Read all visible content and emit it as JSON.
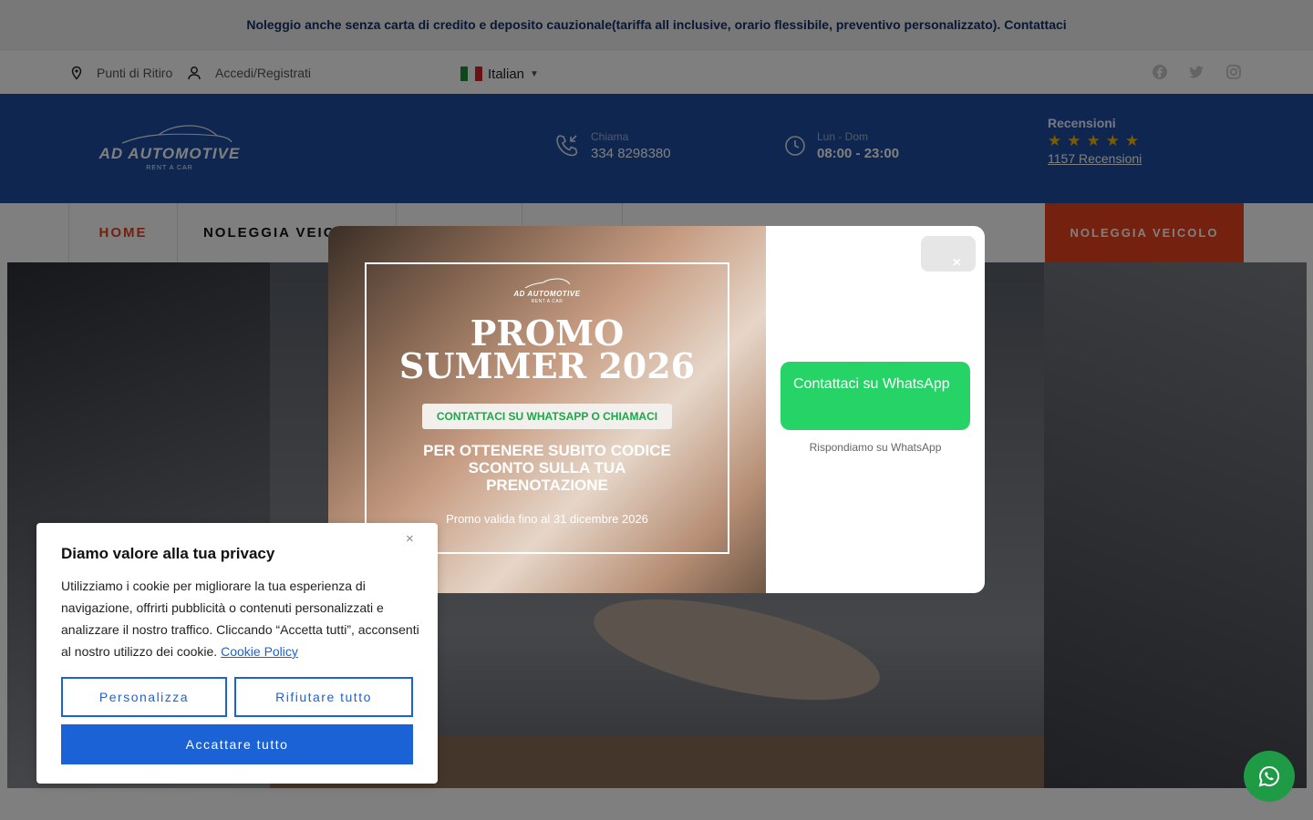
{
  "announcement": "Noleggio anche senza carta di credito e deposito cauzionale(tariffa all inclusive, orario flessibile, preventivo personalizzato). Contattaci",
  "topbar": {
    "pickup_points": "Punti di Ritiro",
    "login": "Accedi/Registrati",
    "language": "Italian",
    "social": [
      "facebook-icon",
      "twitter-icon",
      "instagram-icon"
    ]
  },
  "header": {
    "logo_title": "AD AUTOMOTIVE",
    "logo_subtitle": "RENT A CAR",
    "call_label": "Chiama",
    "call_value": "334 8298380",
    "hours_label": "Lun - Dom",
    "hours_value": "08:00 - 23:00",
    "reviews_title": "Recensioni",
    "rating": "★★★★★",
    "reviews_count": "1157 Recensioni"
  },
  "nav": {
    "items": [
      "HOME",
      "NOLEGGIA VEICOLO"
    ],
    "cta": "NOLEGGIA VEICOLO"
  },
  "promo_modal": {
    "logo_title": "AD AUTOMOTIVE",
    "logo_subtitle": "RENT A CAR",
    "title_line1": "PROMO",
    "title_line2": "SUMMER 2026",
    "pill": "CONTATTACI SU WHATSAPP O CHIAMACI",
    "cta_text": "PER OTTENERE SUBITO CODICE SCONTO SULLA TUA PRENOTAZIONE",
    "validity": "Promo valida fino al 31 dicembre 2026",
    "close_symbol": "×",
    "whatsapp_button": "Contattaci su WhatsApp",
    "whatsapp_subtext": "Rispondiamo su WhatsApp"
  },
  "cookie": {
    "close_symbol": "×",
    "title": "Diamo valore alla tua privacy",
    "body": "Utilizziamo i cookie per migliorare la tua esperienza di navigazione, offrirti pubblicità o contenuti personalizzati e analizzare il nostro traffico. Cliccando “Accetta tutti”, acconsenti al nostro utilizzo dei cookie.",
    "policy_link": "Cookie Policy",
    "customize": "Personalizza",
    "reject": "Rifiutare tutto",
    "accept": "Accattare tutto"
  },
  "colors": {
    "brand_blue": "#1f4fa0",
    "accent_orange": "#e8431e",
    "whatsapp_green": "#25d366",
    "cookie_blue": "#1a62d6"
  }
}
